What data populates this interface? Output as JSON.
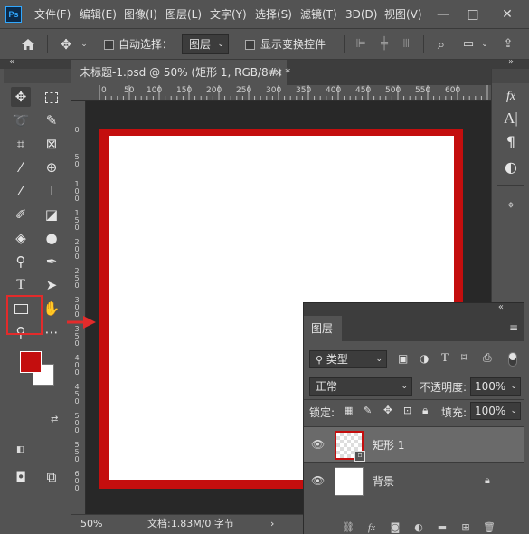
{
  "app": {
    "logo": "Ps",
    "menu": [
      "文件(F)",
      "编辑(E)",
      "图像(I)",
      "图层(L)",
      "文字(Y)",
      "选择(S)",
      "滤镜(T)",
      "3D(D)",
      "视图(V)"
    ],
    "window_controls": {
      "minimize": "—",
      "maximize": "□",
      "close": "✕"
    }
  },
  "options_bar": {
    "auto_select_label": "自动选择：",
    "auto_select_target": "图层",
    "show_transform_label": "显示变换控件"
  },
  "document": {
    "tab_title": "未标题-1.psd @ 50% (矩形 1, RGB/8#) *",
    "tab_close": "×"
  },
  "rulers": {
    "horizontal": [
      "0",
      "50",
      "100",
      "150",
      "200",
      "250",
      "300",
      "350",
      "400",
      "450",
      "500",
      "550",
      "600"
    ],
    "vertical": [
      "0",
      "5 0",
      "1 0 0",
      "1 5 0",
      "2 0 0",
      "2 5 0",
      "3 0 0",
      "3 5 0",
      "4 0 0",
      "4 5 0",
      "5 0 0",
      "5 5 0",
      "6 0 0"
    ]
  },
  "canvas": {
    "border_color": "#c40e0e",
    "fill_color": "#ffffff"
  },
  "status_bar": {
    "zoom": "50%",
    "doc_info": "文档:1.83M/0 字节",
    "arrow": "›"
  },
  "tools": {
    "foreground_color": "#c40e0e",
    "background_color": "#ffffff",
    "highlight_color": "#e32b2b"
  },
  "layers_panel": {
    "collapse": "«",
    "tab_label": "图层",
    "filter_kind": "类型",
    "blend_mode": "正常",
    "opacity_label": "不透明度:",
    "opacity_value": "100%",
    "lock_label": "锁定:",
    "fill_label": "填充:",
    "fill_value": "100%",
    "layers": [
      {
        "name": "矩形 1",
        "selected": true
      },
      {
        "name": "背景",
        "selected": false,
        "locked": true
      }
    ]
  }
}
